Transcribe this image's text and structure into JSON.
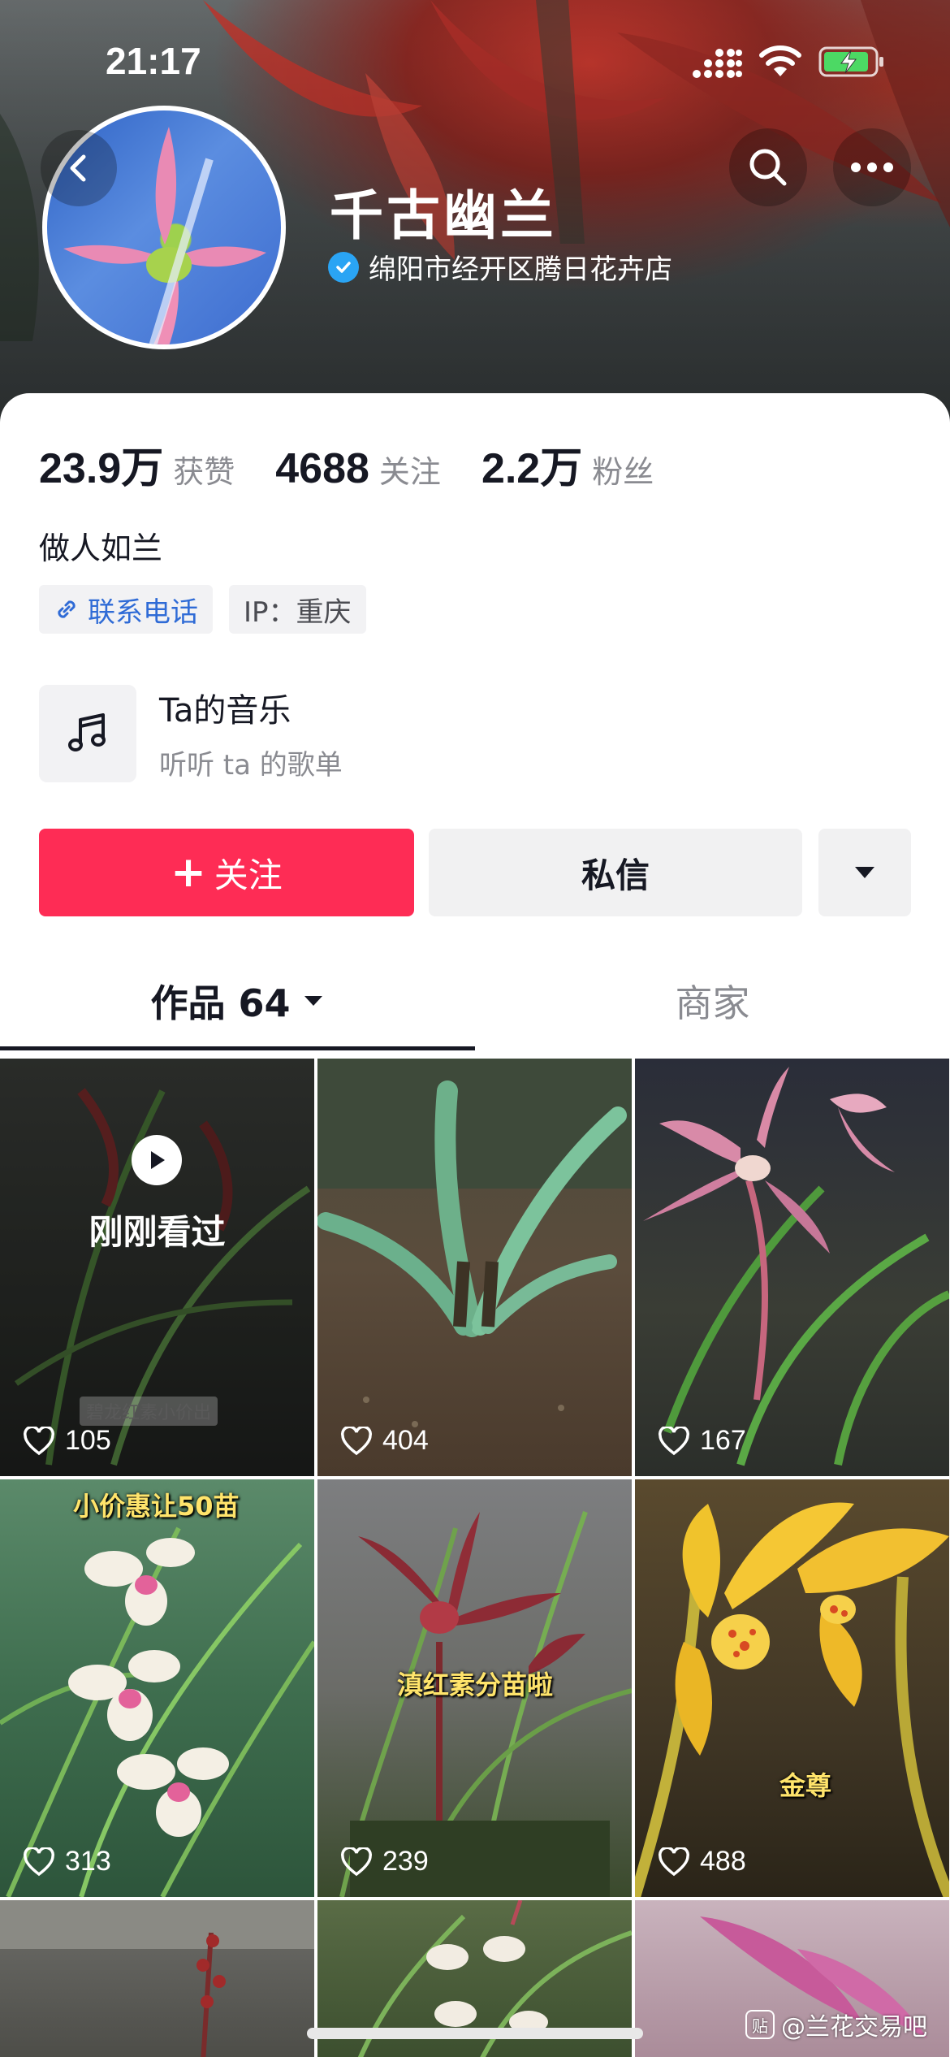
{
  "status_bar": {
    "time": "21:17"
  },
  "profile": {
    "name": "千古幽兰",
    "verified_label": "绵阳市经开区腾日花卉店",
    "stats": [
      {
        "value": "23.9万",
        "label": "获赞"
      },
      {
        "value": "4688",
        "label": "关注"
      },
      {
        "value": "2.2万",
        "label": "粉丝"
      }
    ],
    "bio": "做人如兰",
    "tags": {
      "phone": "联系电话",
      "ip": "IP：重庆"
    },
    "music": {
      "title": "Ta的音乐",
      "subtitle": "听听 ta 的歌单"
    }
  },
  "actions": {
    "follow": "关注",
    "message": "私信"
  },
  "tabs": {
    "works": "作品 64",
    "shop": "商家"
  },
  "grid": {
    "just_watched": "刚刚看过",
    "items": [
      {
        "likes": "105",
        "caption": "碧龙红素小价出"
      },
      {
        "likes": "404",
        "caption": ""
      },
      {
        "likes": "167",
        "caption": ""
      },
      {
        "likes": "313",
        "caption": "小价惠让50苗"
      },
      {
        "likes": "239",
        "caption": "滇红素分苗啦"
      },
      {
        "likes": "488",
        "caption": "金尊"
      }
    ]
  },
  "watermark": "@兰花交易吧",
  "watermark_badge": "贴",
  "colors": {
    "accent": "#fe2c55",
    "link": "#2f6bd6",
    "verify": "#2aa4f4"
  },
  "icons": [
    "back-icon",
    "search-icon",
    "more-icon",
    "verified-icon",
    "link-icon",
    "music-note-icon",
    "plus-icon",
    "caret-down-icon",
    "heart-icon",
    "play-icon"
  ]
}
